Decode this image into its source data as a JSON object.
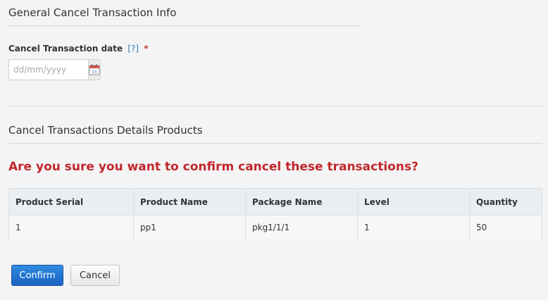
{
  "general": {
    "title": "General Cancel Transaction Info",
    "date_label": "Cancel Transaction date",
    "help_link": "[?]",
    "required_mark": "*",
    "date_placeholder": "dd/mm/yyyy",
    "calendar_icon": "calendar-icon"
  },
  "details": {
    "title": "Cancel Transactions Details Products",
    "warning": "Are you sure you want to confirm cancel these transactions?",
    "columns": [
      "Product Serial",
      "Product Name",
      "Package Name",
      "Level",
      "Quantity"
    ],
    "rows": [
      [
        "1",
        "pp1",
        "pkg1/1/1",
        "1",
        "50"
      ]
    ]
  },
  "actions": {
    "confirm_label": "Confirm",
    "cancel_label": "Cancel"
  },
  "colors": {
    "warning": "#c1272d",
    "primary": "#1a62c2",
    "help_link": "#2a7ab0"
  }
}
